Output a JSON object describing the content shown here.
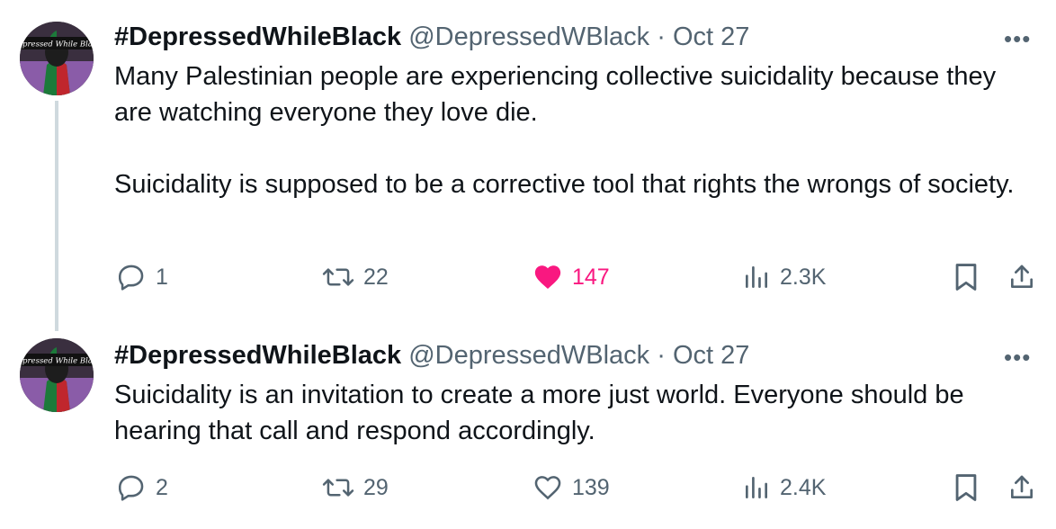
{
  "tweets": [
    {
      "display_name": "#DepressedWhileBlack",
      "handle": "@DepressedWBlack",
      "separator": "·",
      "date": "Oct 27",
      "more_label": "•••",
      "paragraphs": [
        "Many Palestinian people are experiencing collective suicidality because they are watching everyone they love die.",
        "Suicidality is supposed to be a corrective tool that rights the wrongs of society."
      ],
      "replies": "1",
      "retweets": "22",
      "likes": "147",
      "liked": true,
      "views": "2.3K",
      "avatar_text": "Depressed While Black"
    },
    {
      "display_name": "#DepressedWhileBlack",
      "handle": "@DepressedWBlack",
      "separator": "·",
      "date": "Oct 27",
      "more_label": "•••",
      "paragraphs": [
        "Suicidality is an invitation to create a more just world. Everyone should be hearing that call and respond accordingly."
      ],
      "replies": "2",
      "retweets": "29",
      "likes": "139",
      "liked": false,
      "views": "2.4K",
      "avatar_text": "Depressed While Black"
    }
  ],
  "icons": {
    "reply": "reply-icon",
    "retweet": "retweet-icon",
    "like": "heart-icon",
    "views": "views-icon",
    "bookmark": "bookmark-icon",
    "share": "share-icon"
  },
  "colors": {
    "text": "#0f1419",
    "secondary": "#536471",
    "like_active": "#f91880",
    "thread_line": "#cfd9de"
  }
}
